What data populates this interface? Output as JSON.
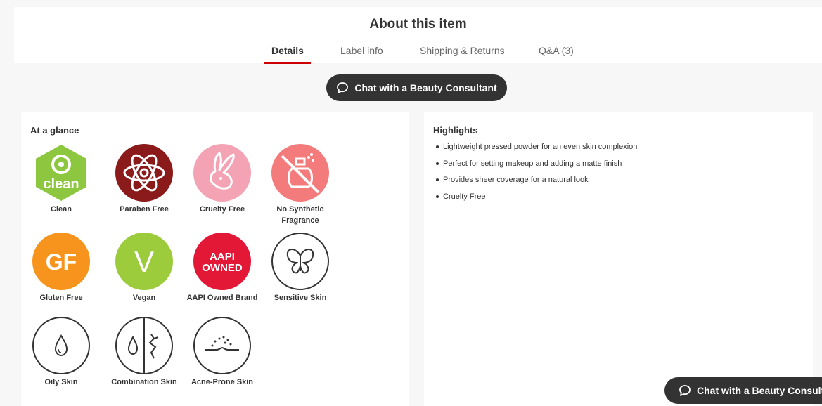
{
  "header": {
    "title": "About this item",
    "tabs": [
      {
        "label": "Details",
        "active": true
      },
      {
        "label": "Label info",
        "active": false
      },
      {
        "label": "Shipping & Returns",
        "active": false
      },
      {
        "label": "Q&A (3)",
        "active": false
      }
    ]
  },
  "chat": {
    "label": "Chat with a Beauty Consultant",
    "floating_label": "Chat with a Beauty Consulta",
    "icon": "chat-bubble-icon"
  },
  "glance": {
    "title": "At a glance",
    "badges": [
      {
        "label": "Clean",
        "icon": "target-clean-icon",
        "color": "#8dc63f",
        "text": "clean"
      },
      {
        "label": "Paraben Free",
        "icon": "atom-icon",
        "color": "#8b1a1a"
      },
      {
        "label": "Cruelty Free",
        "icon": "bunny-icon",
        "color": "#f4a3b5"
      },
      {
        "label": "No Synthetic Fragrance",
        "icon": "no-perfume-icon",
        "color": "#f47b7b"
      },
      {
        "label": "Gluten Free",
        "icon": "gluten-free-icon",
        "color": "#f7941d",
        "text": "GF"
      },
      {
        "label": "Vegan",
        "icon": "vegan-icon",
        "color": "#9ccc3c",
        "text": "V"
      },
      {
        "label": "AAPI Owned Brand",
        "icon": "aapi-owned-icon",
        "color": "#e31837",
        "text_top": "AAPI",
        "text_bottom": "OWNED"
      },
      {
        "label": "Sensitive Skin",
        "icon": "butterfly-icon",
        "color": "#ffffff"
      },
      {
        "label": "Oily Skin",
        "icon": "water-drop-icon",
        "color": "#ffffff"
      },
      {
        "label": "Combination Skin",
        "icon": "combination-skin-icon",
        "color": "#ffffff"
      },
      {
        "label": "Acne-Prone Skin",
        "icon": "acne-prone-icon",
        "color": "#ffffff"
      }
    ]
  },
  "highlights": {
    "title": "Highlights",
    "items": [
      "Lightweight pressed powder for an even skin complexion",
      "Perfect for setting makeup and adding a matte finish",
      "Provides sheer coverage for a natural look",
      "Cruelty Free"
    ]
  },
  "colors": {
    "accent": "#cc0000",
    "button_bg": "#333333"
  }
}
